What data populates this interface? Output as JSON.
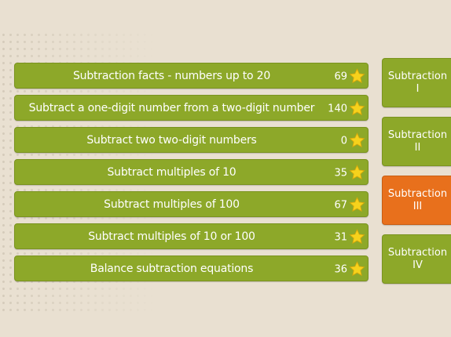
{
  "skills": [
    {
      "label": "Subtraction facts - numbers up to 20",
      "count": "69"
    },
    {
      "label": "Subtract a one-digit number from a two-digit number",
      "count": "140"
    },
    {
      "label": "Subtract two two-digit numbers",
      "count": "0"
    },
    {
      "label": "Subtract multiples of 10",
      "count": "35"
    },
    {
      "label": "Subtract multiples of 100",
      "count": "67"
    },
    {
      "label": "Subtract multiples of 10 or 100",
      "count": "31"
    },
    {
      "label": "Balance subtraction equations",
      "count": "36"
    }
  ],
  "levels": [
    {
      "line1": "Subtraction",
      "line2": "I",
      "active": false
    },
    {
      "line1": "Subtraction",
      "line2": "II",
      "active": false
    },
    {
      "line1": "Subtraction",
      "line2": "III",
      "active": true
    },
    {
      "line1": "Subtraction",
      "line2": "IV",
      "active": false
    }
  ],
  "colors": {
    "row_green": "#8da829",
    "active_orange": "#e8701c",
    "star_yellow": "#f6d21c",
    "background": "#e9e0d1"
  },
  "icons": {
    "star": "star-icon"
  }
}
